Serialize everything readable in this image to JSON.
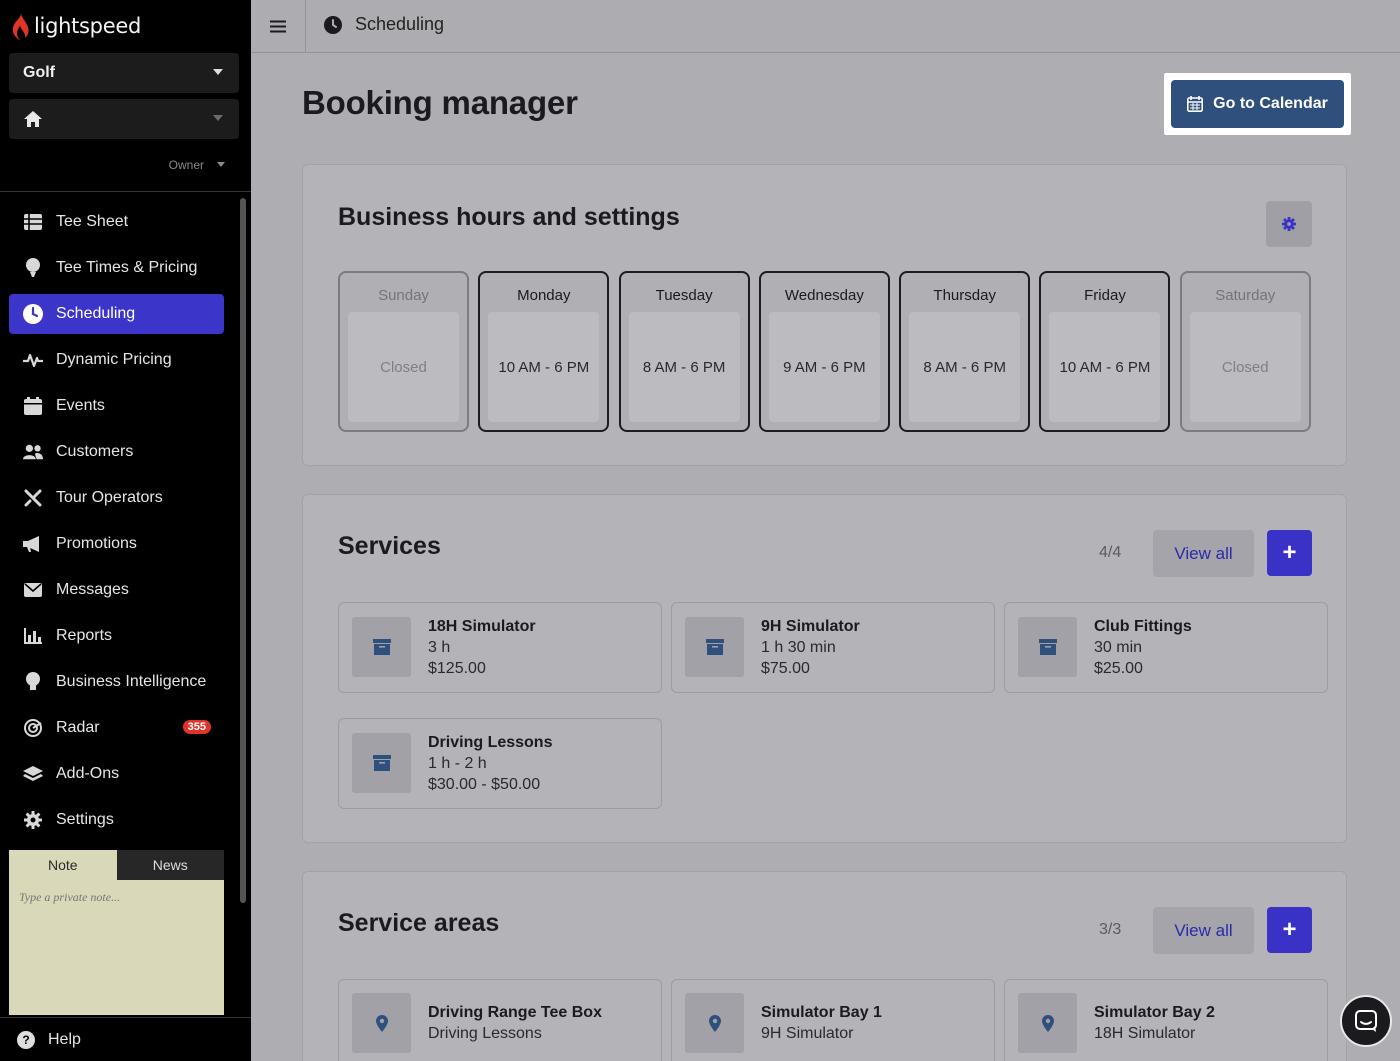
{
  "brand": {
    "name": "lightspeed",
    "accent": "#e0342b"
  },
  "sidebar": {
    "business_select": "Golf",
    "location_select": "",
    "role": "Owner",
    "items": [
      {
        "label": "Tee Sheet",
        "icon": "table-icon"
      },
      {
        "label": "Tee Times & Pricing",
        "icon": "golf-tee-icon"
      },
      {
        "label": "Scheduling",
        "icon": "clock-icon",
        "active": true
      },
      {
        "label": "Dynamic Pricing",
        "icon": "pulse-icon"
      },
      {
        "label": "Events",
        "icon": "calendar-icon"
      },
      {
        "label": "Customers",
        "icon": "users-icon"
      },
      {
        "label": "Tour Operators",
        "icon": "plane-icon"
      },
      {
        "label": "Promotions",
        "icon": "megaphone-icon"
      },
      {
        "label": "Messages",
        "icon": "envelope-icon"
      },
      {
        "label": "Reports",
        "icon": "bar-chart-icon"
      },
      {
        "label": "Business Intelligence",
        "icon": "lightbulb-icon"
      },
      {
        "label": "Radar",
        "icon": "radar-icon",
        "badge": "355"
      },
      {
        "label": "Add-Ons",
        "icon": "layers-icon"
      },
      {
        "label": "Settings",
        "icon": "gear-icon"
      }
    ],
    "notes": {
      "tab_note": "Note",
      "tab_news": "News",
      "placeholder": "Type a private note..."
    },
    "help": "Help"
  },
  "topbar": {
    "title": "Scheduling"
  },
  "main": {
    "title": "Booking manager",
    "calendar_button": "Go to Calendar",
    "hours": {
      "title": "Business hours and settings",
      "days": [
        {
          "name": "Sunday",
          "hours": "Closed",
          "closed": true
        },
        {
          "name": "Monday",
          "hours": "10 AM - 6 PM",
          "closed": false
        },
        {
          "name": "Tuesday",
          "hours": "8 AM - 6 PM",
          "closed": false
        },
        {
          "name": "Wednesday",
          "hours": "9 AM - 6 PM",
          "closed": false
        },
        {
          "name": "Thursday",
          "hours": "8 AM - 6 PM",
          "closed": false
        },
        {
          "name": "Friday",
          "hours": "10 AM - 6 PM",
          "closed": false
        },
        {
          "name": "Saturday",
          "hours": "Closed",
          "closed": true
        }
      ]
    },
    "services": {
      "title": "Services",
      "count": "4/4",
      "view_all": "View all",
      "add": "+",
      "items": [
        {
          "name": "18H Simulator",
          "duration": "3 h",
          "price": "$125.00"
        },
        {
          "name": "9H Simulator",
          "duration": "1 h 30 min",
          "price": "$75.00"
        },
        {
          "name": "Club Fittings",
          "duration": "30 min",
          "price": "$25.00"
        },
        {
          "name": "Driving Lessons",
          "duration": "1 h - 2 h",
          "price": "$30.00 - $50.00"
        }
      ]
    },
    "service_areas": {
      "title": "Service areas",
      "count": "3/3",
      "view_all": "View all",
      "add": "+",
      "items": [
        {
          "name": "Driving Range Tee Box",
          "service": "Driving Lessons"
        },
        {
          "name": "Simulator Bay 1",
          "service": "9H Simulator"
        },
        {
          "name": "Simulator Bay 2",
          "service": "18H Simulator"
        }
      ]
    }
  }
}
